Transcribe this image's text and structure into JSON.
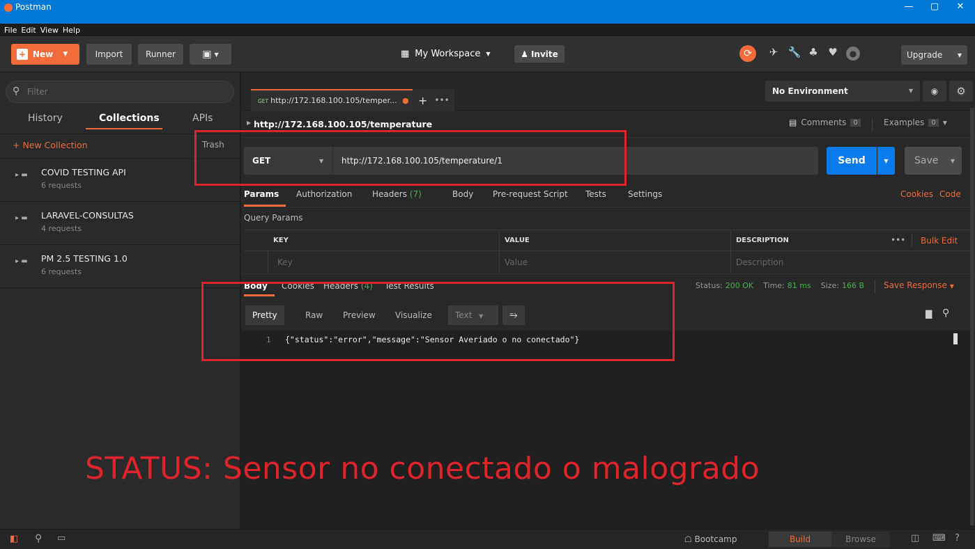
{
  "window": {
    "title": "Postman",
    "controls": {
      "minimize": "—",
      "maximize": "▢",
      "close": "✕"
    }
  },
  "menu": [
    "File",
    "Edit",
    "View",
    "Help"
  ],
  "header": {
    "new_label": "New",
    "import_label": "Import",
    "runner_label": "Runner",
    "workspace_label": "My Workspace",
    "invite_label": "Invite",
    "upgrade_label": "Upgrade"
  },
  "sidebar": {
    "filter_placeholder": "Filter",
    "tabs": [
      "History",
      "Collections",
      "APIs"
    ],
    "active_tab": "Collections",
    "new_collection_label": "+ New Collection",
    "trash_label": "Trash",
    "collections": [
      {
        "name": "COVID TESTING API",
        "requests": "6 requests"
      },
      {
        "name": "LARAVEL-CONSULTAS",
        "requests": "4 requests"
      },
      {
        "name": "PM 2.5 TESTING 1.0",
        "requests": "6 requests"
      }
    ]
  },
  "tab": {
    "method": "GET",
    "title": "http://172.168.100.105/temper..."
  },
  "environment": {
    "selected": "No Environment"
  },
  "breadcrumb": {
    "title": "http://172.168.100.105/temperature",
    "comments_label": "Comments",
    "comments_count": "0",
    "examples_label": "Examples",
    "examples_count": "0"
  },
  "request": {
    "method": "GET",
    "url": "http://172.168.100.105/temperature/1",
    "send_label": "Send",
    "save_label": "Save"
  },
  "request_tabs": {
    "params": "Params",
    "authorization": "Authorization",
    "headers": "Headers",
    "headers_count": "(7)",
    "body": "Body",
    "prerequest": "Pre-request Script",
    "tests": "Tests",
    "settings": "Settings",
    "cookies": "Cookies",
    "code": "Code"
  },
  "query_params": {
    "title": "Query Params",
    "columns": {
      "key": "KEY",
      "value": "VALUE",
      "description": "DESCRIPTION"
    },
    "placeholders": {
      "key": "Key",
      "value": "Value",
      "description": "Description"
    },
    "more": "•••",
    "bulk_edit": "Bulk Edit"
  },
  "response": {
    "tabs": {
      "body": "Body",
      "cookies": "Cookies",
      "headers": "Headers",
      "headers_count": "(4)",
      "test_results": "Test Results"
    },
    "status_label": "Status:",
    "status_value": "200 OK",
    "time_label": "Time:",
    "time_value": "81 ms",
    "size_label": "Size:",
    "size_value": "166 B",
    "save_response": "Save Response",
    "views": [
      "Pretty",
      "Raw",
      "Preview",
      "Visualize"
    ],
    "active_view": "Pretty",
    "format": "Text",
    "line_number": "1",
    "body": "{\"status\":\"error\",\"message\":\"Sensor Averiado o no conectado\"}"
  },
  "annotation": {
    "text": "STATUS: Sensor no conectado o malogrado",
    "color": "#e0242c"
  },
  "footer": {
    "bootcamp": "Bootcamp",
    "build": "Build",
    "browse": "Browse"
  },
  "colors": {
    "accent": "#f26b3a",
    "send_blue": "#097bed",
    "status_green": "#4caf50",
    "titlebar": "#0078d7"
  }
}
